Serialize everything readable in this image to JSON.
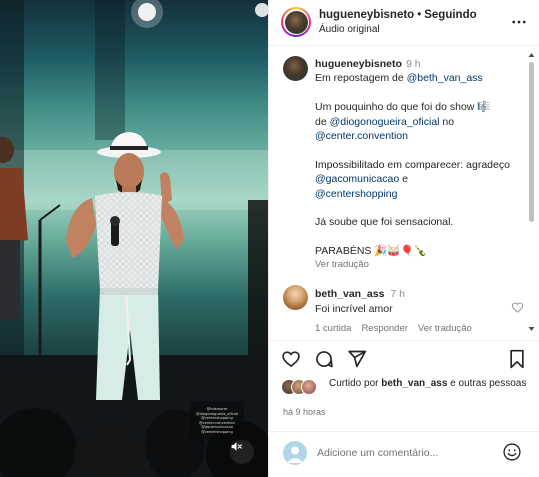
{
  "header": {
    "username": "hugueneybisneto",
    "separator": "•",
    "follow_label": "Seguindo",
    "audio_label": "Áudio original"
  },
  "caption": {
    "username": "hugueneybisneto",
    "time": "9 h",
    "line1_text": "Em repostagem de ",
    "line1_mention": "@beth_van_ass",
    "para2_text1": "Um pouquinho do que foi do show ",
    "para2_emoji": "🎼",
    "para2_text2": "de ",
    "para2_mention1": "@diogonogueira_oficial",
    "para2_text3": " no",
    "para2_mention2": "@center.convention",
    "para3_text1": "Impossibilitado em comparecer: agradeço ",
    "para3_mention1": "@gacomunicacao",
    "para3_text2": " e",
    "para3_mention2": "@centershopping",
    "para4": "Já soube que foi sensacional.",
    "para5": "PARABÉNS 🎉🥁🎈🍾",
    "see_translation": "Ver tradução"
  },
  "comment": {
    "username": "beth_van_ass",
    "time": "7 h",
    "text": "Foi incrível amor",
    "replies": "1 curtida",
    "reply_label": "Responder",
    "translate_label": "Ver tradução"
  },
  "likes": {
    "prefix": "Curtido por ",
    "user": "beth_van_ass",
    "suffix": " e outras pessoas"
  },
  "post_time": "há 9 horas",
  "add_comment": {
    "placeholder": "Adicione um comentário..."
  },
  "media": {
    "sticker_lines": [
      "@hdsmorre",
      "@diogonogueira_oficial",
      "@centershopping",
      "@center.convention",
      "@gacomunicacao",
      "@centershopping"
    ]
  },
  "colors": {
    "link": "#00376b",
    "muted": "#737373",
    "text": "#262626",
    "border": "#efefef"
  }
}
